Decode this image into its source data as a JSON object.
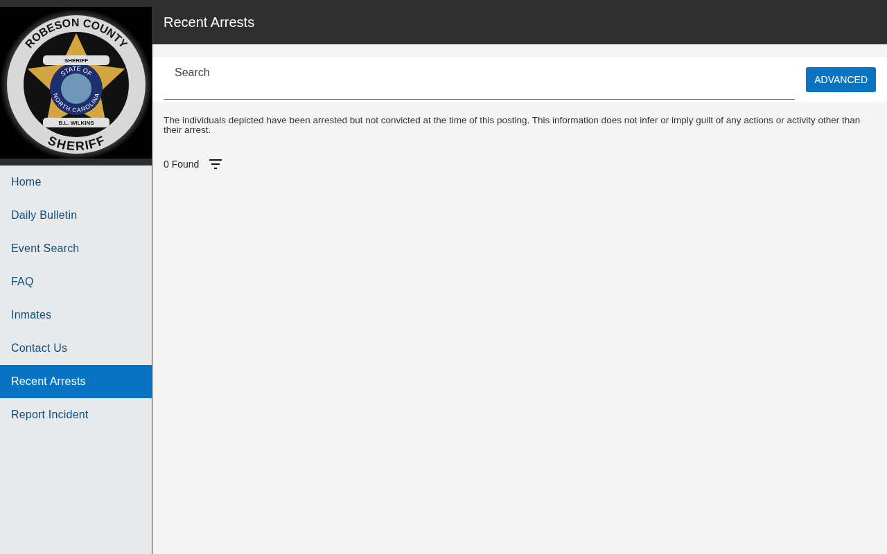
{
  "logo": {
    "ring_top": "ROBESON COUNTY",
    "ring_bottom": "SHERIFF",
    "banner_top": "SHERIFF",
    "seal_top": "STATE OF",
    "seal_bottom": "NORTH CAROLINA",
    "banner_bottom": "B.L. WILKINS"
  },
  "sidebar": {
    "items": [
      {
        "label": "Home",
        "selected": false
      },
      {
        "label": "Daily Bulletin",
        "selected": false
      },
      {
        "label": "Event Search",
        "selected": false
      },
      {
        "label": "FAQ",
        "selected": false
      },
      {
        "label": "Inmates",
        "selected": false
      },
      {
        "label": "Contact Us",
        "selected": false
      },
      {
        "label": "Recent Arrests",
        "selected": true
      },
      {
        "label": "Report Incident",
        "selected": false
      }
    ]
  },
  "header": {
    "title": "Recent Arrests"
  },
  "search": {
    "placeholder": "Search",
    "button": "ADVANCED"
  },
  "disclaimer": "The individuals depicted have been arrested but not convicted at the time of this posting. This information does not infer or imply guilt of any actions or activity other than their arrest.",
  "results": {
    "count": "0 Found"
  }
}
